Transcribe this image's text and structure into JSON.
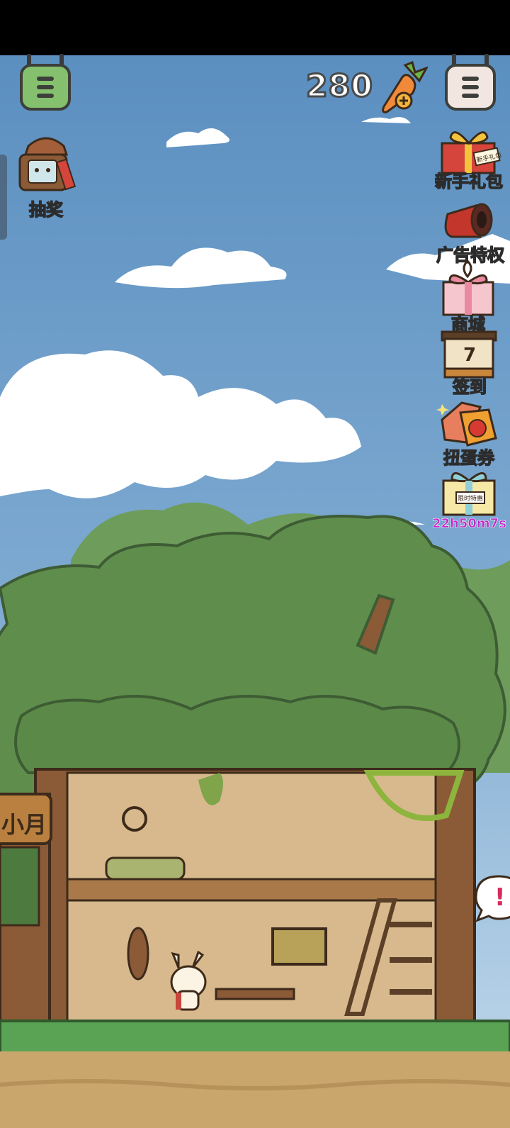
{
  "hud": {
    "carrot_count": "280",
    "left_menu_icon": "menu-icon",
    "right_menu_icon": "menu-icon",
    "currency_icon": "carrot-plus-icon"
  },
  "sidebar_left": {
    "lottery": {
      "label": "抽奖",
      "icon": "lottery-lantern-icon"
    }
  },
  "sidebar_right": {
    "items": [
      {
        "label": "新手礼包",
        "icon": "gift-box-icon"
      },
      {
        "label": "广告特权",
        "icon": "ad-privilege-icon"
      },
      {
        "label": "商城",
        "icon": "shop-gift-icon"
      },
      {
        "label": "签到",
        "icon": "calendar-icon",
        "badge": "7"
      },
      {
        "label": "扭蛋券",
        "icon": "gacha-ticket-icon"
      }
    ],
    "limited_offer": {
      "timer": "22h50m7s",
      "icon": "limited-gift-icon",
      "tag": "限时特惠"
    }
  },
  "gift_tag": "新手礼包",
  "scene": {
    "sign_text": "小月",
    "speech_bubble": "!"
  },
  "colors": {
    "sky_top": "#5c93c2",
    "sky_bottom": "#a9c8e2",
    "tree_green": "#5f8e4c",
    "trunk": "#8b5a36",
    "wall": "#d8b98e",
    "grass": "#5aa355",
    "ground": "#c9a66c",
    "timer": "#c326c9"
  }
}
